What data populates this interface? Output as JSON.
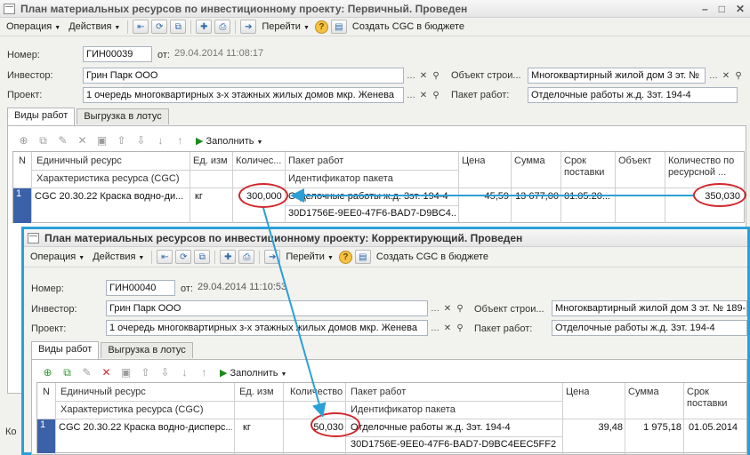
{
  "w1": {
    "title": "План материальных ресурсов по инвестиционному проекту: Первичный. Проведен",
    "toolbar": {
      "operation": "Операция",
      "actions": "Действия",
      "goto": "Перейти",
      "create": "Создать CGC в бюджете"
    },
    "number_label": "Номер:",
    "number": "ГИН00039",
    "date_label": "от:",
    "date": "29.04.2014 11:08:17",
    "investor_label": "Инвестор:",
    "investor": "Грин Парк ООО",
    "object_label": "Объект строи...",
    "object": "Многоквартирный жилой дом 3 эт. №",
    "project_label": "Проект:",
    "project": "1 очередь многоквартирных з-х этажных жилых домов мкр. Женева",
    "package_label": "Пакет работ:",
    "package": "Отделочные работы ж.д. 3эт. 194-4",
    "tabs": [
      "Виды работ",
      "Выгрузка в лотус"
    ],
    "fill": "Заполнить",
    "headers": {
      "n": "N",
      "resource": "Единичный ресурс",
      "characteristic": "Характеристика ресурса (CGC)",
      "unit": "Ед. изм",
      "qty": "Количес...",
      "pkg": "Пакет работ",
      "pkg_id": "Идентификатор пакета",
      "price": "Цена",
      "sum": "Сумма",
      "term": "Срок поставки",
      "obj": "Объект",
      "qty_res": "Количество по ресурсной ..."
    },
    "row": {
      "n": "1",
      "resource": "CGC 20.30.22 Краска водно-ди...",
      "unit": "кг",
      "qty": "300,000",
      "pkg": "Отделочные работы ж.д. 3эт. 194-4",
      "pkg_id": "30D1756E-9EE0-47F6-BAD7-D9BC4...",
      "price": "45,59",
      "sum": "13 677,00",
      "term": "01.05.20...",
      "qty_res": "350,030"
    },
    "bottom_label": "Ко"
  },
  "w2": {
    "title": "План материальных ресурсов по инвестиционному проекту: Корректирующий. Проведен",
    "toolbar": {
      "operation": "Операция",
      "actions": "Действия",
      "goto": "Перейти",
      "create": "Создать CGC в бюджете"
    },
    "number_label": "Номер:",
    "number": "ГИН00040",
    "date_label": "от:",
    "date": "29.04.2014 11:10:53",
    "investor_label": "Инвестор:",
    "investor": "Грин Парк ООО",
    "object_label": "Объект строи...",
    "object": "Многоквартирный жилой дом 3 эт. № 189-",
    "project_label": "Проект:",
    "project": "1 очередь многоквартирных з-х этажных жилых домов мкр. Женева",
    "package_label": "Пакет работ:",
    "package": "Отделочные работы ж.д. 3эт. 194-4",
    "tabs": [
      "Виды работ",
      "Выгрузка в лотус"
    ],
    "fill": "Заполнить",
    "headers": {
      "n": "N",
      "resource": "Единичный ресурс",
      "characteristic": "Характеристика ресурса (CGC)",
      "unit": "Ед. изм",
      "qty": "Количество",
      "pkg": "Пакет работ",
      "pkg_id": "Идентификатор пакета",
      "price": "Цена",
      "sum": "Сумма",
      "term": "Срок поставки"
    },
    "row": {
      "n": "1",
      "resource": "CGC 20.30.22 Краска водно-дисперс...",
      "unit": "кг",
      "qty": "50,030",
      "pkg": "Отделочные работы ж.д. 3эт. 194-4",
      "pkg_id": "30D1756E-9EE0-47F6-BAD7-D9BC4EEC5FF2",
      "price": "39,48",
      "sum": "1 975,18",
      "term": "01.05.2014"
    }
  },
  "colors": {
    "highlight": "#2aa0d6",
    "ellipse": "#d1262b",
    "rownum": "#3b62a8"
  }
}
